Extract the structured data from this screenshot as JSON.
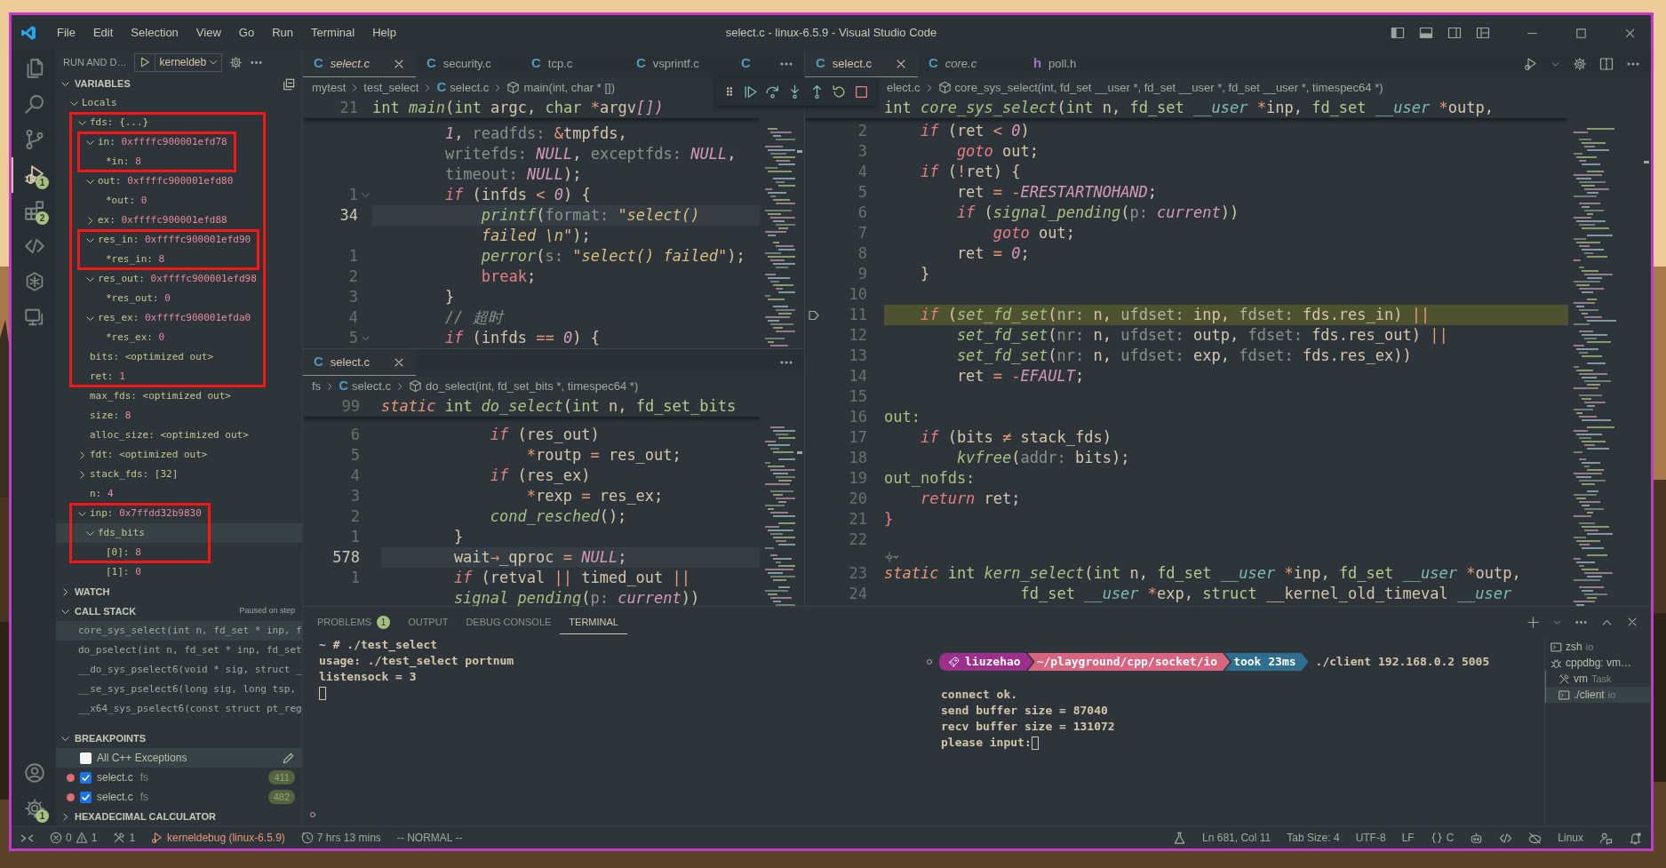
{
  "title_bar": {
    "menu": [
      "File",
      "Edit",
      "Selection",
      "View",
      "Go",
      "Run",
      "Terminal",
      "Help"
    ],
    "title": "select.c - linux-6.5.9 - Visual Studio Code"
  },
  "activity_bar": {
    "top": [
      {
        "kind": "files",
        "selected": false
      },
      {
        "kind": "search",
        "selected": false
      },
      {
        "kind": "source-control",
        "selected": false
      },
      {
        "kind": "run-debug",
        "selected": true,
        "badge": "1"
      },
      {
        "kind": "extensions",
        "selected": false,
        "badge": "2"
      },
      {
        "kind": "code",
        "selected": false
      },
      {
        "kind": "hexagon",
        "selected": false
      },
      {
        "kind": "monitor",
        "selected": false
      }
    ],
    "bottom": [
      {
        "kind": "account",
        "selected": false
      },
      {
        "kind": "gear",
        "selected": false,
        "badge": "1"
      }
    ]
  },
  "sidebar": {
    "title": "RUN AND D…",
    "launch_config": "kerneldeb",
    "variables": {
      "title": "VARIABLES",
      "expanded": true,
      "tree": [
        {
          "name": "Locals",
          "expanded": true,
          "children": [
            {
              "name": "fds:",
              "value": "{...}",
              "kind": "text",
              "expanded": true,
              "outline_start": true,
              "children": [
                {
                  "name": "in:",
                  "value": "0xffffc900001efd78",
                  "kind": "number",
                  "expanded": true,
                  "outline_start": true,
                  "children": [
                    {
                      "name": "*in:",
                      "value": "8",
                      "kind": "number",
                      "outline_end": true
                    }
                  ]
                },
                {
                  "name": "out:",
                  "value": "0xffffc900001efd80",
                  "kind": "number",
                  "expanded": true,
                  "children": [
                    {
                      "name": "*out:",
                      "value": "0",
                      "kind": "number"
                    }
                  ]
                },
                {
                  "name": "ex:",
                  "value": "0xffffc900001efd88",
                  "kind": "number",
                  "expanded": false
                },
                {
                  "name": "res_in:",
                  "value": "0xffffc900001efd90",
                  "kind": "number",
                  "expanded": true,
                  "outline_start": true,
                  "children": [
                    {
                      "name": "*res_in:",
                      "value": "8",
                      "kind": "number",
                      "outline_end": true
                    }
                  ]
                },
                {
                  "name": "res_out:",
                  "value": "0xffffc900001efd98",
                  "kind": "number",
                  "expanded": true,
                  "children": [
                    {
                      "name": "*res_out:",
                      "value": "0",
                      "kind": "number"
                    }
                  ]
                },
                {
                  "name": "res_ex:",
                  "value": "0xffffc900001efda0",
                  "kind": "number",
                  "expanded": true,
                  "children": [
                    {
                      "name": "*res_ex:",
                      "value": "0",
                      "kind": "number"
                    }
                  ]
                }
              ]
            },
            {
              "name": "bits:",
              "value": "<optimized out>",
              "kind": "text"
            },
            {
              "name": "ret:",
              "value": "1",
              "kind": "number",
              "outline_end": true
            },
            {
              "name": "max_fds:",
              "value": "<optimized out>",
              "kind": "text"
            },
            {
              "name": "size:",
              "value": "8",
              "kind": "number"
            },
            {
              "name": "alloc_size:",
              "value": "<optimized out>",
              "kind": "text"
            },
            {
              "name": "fdt:",
              "value": "<optimized out>",
              "kind": "text",
              "expanded": false
            },
            {
              "name": "stack_fds:",
              "value": "[32]",
              "kind": "text",
              "expanded": false
            },
            {
              "name": "n:",
              "value": "4",
              "kind": "number"
            },
            {
              "name": "inp:",
              "value": "0x7ffdd32b9830",
              "kind": "number",
              "expanded": true,
              "outline_start": true,
              "children": [
                {
                  "name": "fds_bits",
                  "expanded": true,
                  "highlighted": true,
                  "children": [
                    {
                      "name": "[0]:",
                      "value": "8",
                      "kind": "number",
                      "outline_end": true
                    },
                    {
                      "name": "[1]:",
                      "value": "0",
                      "kind": "number"
                    }
                  ]
                }
              ]
            }
          ]
        }
      ]
    },
    "watch": {
      "title": "WATCH",
      "expanded": false
    },
    "call_stack": {
      "title": "CALL STACK",
      "expanded": true,
      "status": "Paused on step",
      "frames": [
        {
          "text": "core_sys_select(int n, fd_set * inp, f",
          "selected": true
        },
        {
          "text": "do_pselect(int n, fd_set * inp, fd_set",
          "selected": false
        },
        {
          "text": "__do_sys_pselect6(void * sig, struct _",
          "selected": false
        },
        {
          "text": "__se_sys_pselect6(long sig, long tsp,",
          "selected": false
        },
        {
          "text": "__x64_sys_pselect6(const struct pt_reg",
          "selected": false
        }
      ]
    },
    "breakpoints": {
      "title": "BREAKPOINTS",
      "expanded": true,
      "items": [
        {
          "kind": "exception",
          "label": "All C++ Exceptions",
          "checked": false,
          "highlighted": true
        },
        {
          "kind": "source",
          "label": "select.c",
          "folder": "fs",
          "line": "411",
          "checked": true
        },
        {
          "kind": "source",
          "label": "select.c",
          "folder": "fs",
          "line": "482",
          "checked": true
        }
      ]
    },
    "hex_calculator": {
      "title": "HEXADECIMAL CALCULATOR",
      "expanded": false
    }
  },
  "debug_toolbar": {
    "buttons": [
      {
        "kind": "continue"
      },
      {
        "kind": "step-over"
      },
      {
        "kind": "step-into"
      },
      {
        "kind": "step-out"
      },
      {
        "kind": "restart"
      },
      {
        "kind": "stop"
      }
    ]
  },
  "editor_columns": [
    {
      "editors": [
        {
          "tabs": [
            {
              "glyph": "C",
              "color": "#519aba",
              "label": "select.c",
              "selected": true,
              "preview": true,
              "close_button": true
            },
            {
              "glyph": "C",
              "color": "#519aba",
              "label": "security.c",
              "selected": false
            },
            {
              "glyph": "C",
              "color": "#519aba",
              "label": "tcp.c",
              "selected": false
            },
            {
              "glyph": "C",
              "color": "#519aba",
              "label": "vsprintf.c",
              "selected": false
            },
            {
              "glyph": "C",
              "color": "#519aba",
              "selected": false
            }
          ],
          "actions": [
            {
              "kind": "more"
            }
          ],
          "breadcrumb": [
            {
              "kind": "folder",
              "text": "mytest"
            },
            {
              "kind": "folder",
              "text": "test_select"
            },
            {
              "kind": "file",
              "glyph": "C",
              "color": "#519aba",
              "text": "select.c"
            },
            {
              "kind": "symbol",
              "text": "main(int, char * [])"
            }
          ],
          "sticky": {
            "number": "21",
            "tokens": [
              {
                "kind": "ty",
                "text": "int"
              },
              {
                "kind": "fn",
                "text": " main"
              },
              {
                "kind": "pl",
                "text": "("
              },
              {
                "kind": "ty",
                "text": "int"
              },
              {
                "kind": "pl",
                "text": " argc, "
              },
              {
                "kind": "ty",
                "text": "char"
              },
              {
                "kind": "op",
                "text": " *"
              },
              {
                "kind": "pl",
                "text": "argv"
              },
              {
                "kind": "num",
                "text": "[])"
              }
            ]
          },
          "lines": [
            {
              "tokens": [
                {
                  "kind": "num",
                  "text": "        1"
                },
                {
                  "kind": "pl",
                  "text": ", "
                },
                {
                  "kind": "hint",
                  "text": "readfds:"
                },
                {
                  "kind": "op",
                  "text": " &"
                },
                {
                  "kind": "pl",
                  "text": "tmpfds,"
                }
              ]
            },
            {
              "tokens": [
                {
                  "kind": "hint",
                  "text": "        writefds:"
                },
                {
                  "kind": "num",
                  "text": " NULL"
                },
                {
                  "kind": "pl",
                  "text": ", "
                },
                {
                  "kind": "hint",
                  "text": "exceptfds:"
                },
                {
                  "kind": "num",
                  "text": " NULL"
                },
                {
                  "kind": "pl",
                  "text": ","
                }
              ]
            },
            {
              "tokens": [
                {
                  "kind": "hint",
                  "text": "        timeout:"
                },
                {
                  "kind": "num",
                  "text": " NULL"
                },
                {
                  "kind": "pl",
                  "text": ");"
                }
              ]
            },
            {
              "number": "1",
              "foldable": true,
              "tokens": [
                {
                  "kind": "kw",
                  "text": "        if"
                },
                {
                  "kind": "pl",
                  "text": " (infds "
                },
                {
                  "kind": "op",
                  "text": "<"
                },
                {
                  "kind": "num",
                  "text": " 0"
                },
                {
                  "kind": "pl",
                  "text": ") {"
                }
              ]
            },
            {
              "number": "34",
              "current": true,
              "tokens": [
                {
                  "kind": "fn",
                  "text": "            printf"
                },
                {
                  "kind": "pl",
                  "text": "("
                },
                {
                  "kind": "hint",
                  "text": "format:"
                },
                {
                  "kind": "str",
                  "text": " \"select()"
                }
              ]
            },
            {
              "tokens": [
                {
                  "kind": "str",
                  "text": "            failed \\n\""
                },
                {
                  "kind": "pl",
                  "text": ");"
                }
              ]
            },
            {
              "number": "1",
              "tokens": [
                {
                  "kind": "fn",
                  "text": "            perror"
                },
                {
                  "kind": "pl",
                  "text": "("
                },
                {
                  "kind": "hint",
                  "text": "s:"
                },
                {
                  "kind": "str",
                  "text": " \"select() failed\""
                },
                {
                  "kind": "pl",
                  "text": ");"
                }
              ]
            },
            {
              "number": "2",
              "tokens": [
                {
                  "kind": "br",
                  "text": "            break"
                },
                {
                  "kind": "pl",
                  "text": ";"
                }
              ]
            },
            {
              "number": "3",
              "tokens": [
                {
                  "kind": "pl",
                  "text": "        }"
                }
              ]
            },
            {
              "number": "4",
              "tokens": [
                {
                  "kind": "cmt",
                  "text": "        // 超时"
                }
              ]
            },
            {
              "number": "5",
              "foldable": true,
              "tokens": [
                {
                  "kind": "kw",
                  "text": "        if"
                },
                {
                  "kind": "pl",
                  "text": " (infds "
                },
                {
                  "kind": "op",
                  "text": "=="
                },
                {
                  "kind": "num",
                  "text": " 0"
                },
                {
                  "kind": "pl",
                  "text": ") {"
                }
              ]
            }
          ]
        },
        {
          "tabs": [
            {
              "glyph": "C",
              "color": "#519aba",
              "label": "select.c",
              "selected": true,
              "close_button": true
            }
          ],
          "actions": [
            {
              "kind": "more"
            }
          ],
          "breadcrumb": [
            {
              "kind": "folder",
              "text": "fs"
            },
            {
              "kind": "file",
              "glyph": "C",
              "color": "#519aba",
              "text": "select.c"
            },
            {
              "kind": "symbol",
              "text": "do_select(int, fd_set_bits *, timespec64 *)"
            }
          ],
          "sticky": {
            "number": "99",
            "tokens": [
              {
                "kind": "sto",
                "text": "static"
              },
              {
                "kind": "ty",
                "text": " int"
              },
              {
                "kind": "fn",
                "text": " do_select"
              },
              {
                "kind": "pl",
                "text": "("
              },
              {
                "kind": "ty",
                "text": "int"
              },
              {
                "kind": "pl",
                "text": " n, "
              },
              {
                "kind": "ty",
                "text": "fd_set_bits"
              }
            ]
          },
          "lines": [
            {
              "number": "6",
              "tokens": [
                {
                  "kind": "kw",
                  "text": "            if"
                },
                {
                  "kind": "pl",
                  "text": " (res_out)"
                }
              ]
            },
            {
              "number": "5",
              "tokens": [
                {
                  "kind": "op",
                  "text": "                *"
                },
                {
                  "kind": "pl",
                  "text": "routp "
                },
                {
                  "kind": "op",
                  "text": "="
                },
                {
                  "kind": "pl",
                  "text": " res_out;"
                }
              ]
            },
            {
              "number": "4",
              "tokens": [
                {
                  "kind": "kw",
                  "text": "            if"
                },
                {
                  "kind": "pl",
                  "text": " (res_ex)"
                }
              ]
            },
            {
              "number": "3",
              "tokens": [
                {
                  "kind": "op",
                  "text": "                *"
                },
                {
                  "kind": "pl",
                  "text": "rexp "
                },
                {
                  "kind": "op",
                  "text": "="
                },
                {
                  "kind": "pl",
                  "text": " res_ex;"
                }
              ]
            },
            {
              "number": "2",
              "tokens": [
                {
                  "kind": "fn",
                  "text": "            cond_resched"
                },
                {
                  "kind": "pl",
                  "text": "();"
                }
              ]
            },
            {
              "number": "1",
              "tokens": [
                {
                  "kind": "pl",
                  "text": "        }"
                }
              ]
            },
            {
              "number": "578",
              "current": true,
              "tokens": [
                {
                  "kind": "pl",
                  "text": "        wait"
                },
                {
                  "kind": "op",
                  "text": "→"
                },
                {
                  "kind": "pl",
                  "text": "_qproc "
                },
                {
                  "kind": "op",
                  "text": "="
                },
                {
                  "kind": "num",
                  "text": " NULL"
                },
                {
                  "kind": "pl",
                  "text": ";"
                }
              ]
            },
            {
              "number": "1",
              "tokens": [
                {
                  "kind": "kw",
                  "text": "        if"
                },
                {
                  "kind": "pl",
                  "text": " (retval "
                },
                {
                  "kind": "op",
                  "text": "||"
                },
                {
                  "kind": "pl",
                  "text": " timed_out "
                },
                {
                  "kind": "op",
                  "text": "||"
                }
              ]
            },
            {
              "tokens": [
                {
                  "kind": "fn",
                  "text": "        signal_pending"
                },
                {
                  "kind": "pl",
                  "text": "("
                },
                {
                  "kind": "hint",
                  "text": "p:"
                },
                {
                  "kind": "num",
                  "text": " current"
                },
                {
                  "kind": "pl",
                  "text": "))"
                }
              ]
            }
          ]
        }
      ]
    },
    {
      "editors": [
        {
          "tabs": [
            {
              "glyph": "C",
              "color": "#519aba",
              "label": "select.c",
              "selected": true,
              "close_button": true
            },
            {
              "glyph": "C",
              "color": "#519aba",
              "label": "core.c",
              "selected": false,
              "preview": true
            },
            {
              "glyph": "h",
              "color": "#a074c4",
              "label": "poll.h",
              "selected": false
            }
          ],
          "actions": [
            {
              "kind": "run"
            },
            {
              "kind": "gear"
            },
            {
              "kind": "split"
            },
            {
              "kind": "more"
            }
          ],
          "breadcrumb": [
            {
              "kind": "file",
              "text": "elect.c"
            },
            {
              "kind": "symbol",
              "text": "core_sys_select(int, fd_set __user *, fd_set __user *, fd_set __user *, timespec64 *)"
            }
          ],
          "sticky": {
            "tokens": [
              {
                "kind": "ty",
                "text": "int"
              },
              {
                "kind": "fn",
                "text": " core_sys_select"
              },
              {
                "kind": "pl",
                "text": "("
              },
              {
                "kind": "ty",
                "text": "int"
              },
              {
                "kind": "pl",
                "text": " n, "
              },
              {
                "kind": "ty",
                "text": "fd_set"
              },
              {
                "kind": "qual",
                "text": " __user"
              },
              {
                "kind": "op",
                "text": " *"
              },
              {
                "kind": "pl",
                "text": "inp, "
              },
              {
                "kind": "ty",
                "text": "fd_set"
              },
              {
                "kind": "qual",
                "text": " __user"
              },
              {
                "kind": "op",
                "text": " *"
              },
              {
                "kind": "pl",
                "text": "outp,"
              }
            ]
          },
          "lines": [
            {
              "number": "2",
              "tokens": [
                {
                  "kind": "kw",
                  "text": "    if"
                },
                {
                  "kind": "pl",
                  "text": " (ret "
                },
                {
                  "kind": "op",
                  "text": "<"
                },
                {
                  "kind": "num",
                  "text": " 0"
                },
                {
                  "kind": "pl",
                  "text": ")"
                }
              ]
            },
            {
              "number": "3",
              "tokens": [
                {
                  "kind": "kw",
                  "text": "        goto"
                },
                {
                  "kind": "pl",
                  "text": " out;"
                }
              ]
            },
            {
              "number": "4",
              "tokens": [
                {
                  "kind": "kw",
                  "text": "    if"
                },
                {
                  "kind": "pl",
                  "text": " ("
                },
                {
                  "kind": "op",
                  "text": "!"
                },
                {
                  "kind": "pl",
                  "text": "ret) {"
                }
              ]
            },
            {
              "number": "5",
              "tokens": [
                {
                  "kind": "pl",
                  "text": "        ret "
                },
                {
                  "kind": "op",
                  "text": "= -"
                },
                {
                  "kind": "num",
                  "text": "ERESTARTNOHAND"
                },
                {
                  "kind": "pl",
                  "text": ";"
                }
              ]
            },
            {
              "number": "6",
              "tokens": [
                {
                  "kind": "kw",
                  "text": "        if"
                },
                {
                  "kind": "pl",
                  "text": " ("
                },
                {
                  "kind": "fn",
                  "text": "signal_pending"
                },
                {
                  "kind": "pl",
                  "text": "("
                },
                {
                  "kind": "hint",
                  "text": "p:"
                },
                {
                  "kind": "num",
                  "text": " current"
                },
                {
                  "kind": "pl",
                  "text": "))"
                }
              ]
            },
            {
              "number": "7",
              "tokens": [
                {
                  "kind": "kw",
                  "text": "            goto"
                },
                {
                  "kind": "pl",
                  "text": " out;"
                }
              ]
            },
            {
              "number": "8",
              "tokens": [
                {
                  "kind": "pl",
                  "text": "        ret "
                },
                {
                  "kind": "op",
                  "text": "="
                },
                {
                  "kind": "num",
                  "text": " 0"
                },
                {
                  "kind": "pl",
                  "text": ";"
                }
              ]
            },
            {
              "number": "9",
              "tokens": [
                {
                  "kind": "pl",
                  "text": "    }"
                }
              ]
            },
            {
              "number": "10"
            },
            {
              "number": "11",
              "paused": true,
              "tokens": [
                {
                  "kind": "kw",
                  "text": "    if"
                },
                {
                  "kind": "pl",
                  "text": " ("
                },
                {
                  "kind": "fn",
                  "text": "set_fd_set"
                },
                {
                  "kind": "pl",
                  "text": "("
                },
                {
                  "kind": "hint",
                  "text": "nr:"
                },
                {
                  "kind": "pl",
                  "text": " n, "
                },
                {
                  "kind": "hint",
                  "text": "ufdset:"
                },
                {
                  "kind": "pl",
                  "text": " inp, "
                },
                {
                  "kind": "hint",
                  "text": "fdset:"
                },
                {
                  "kind": "pl",
                  "text": " fds.res_in) "
                },
                {
                  "kind": "op",
                  "text": "||"
                }
              ]
            },
            {
              "number": "12",
              "tokens": [
                {
                  "kind": "fn",
                  "text": "        set_fd_set"
                },
                {
                  "kind": "pl",
                  "text": "("
                },
                {
                  "kind": "hint",
                  "text": "nr:"
                },
                {
                  "kind": "pl",
                  "text": " n, "
                },
                {
                  "kind": "hint",
                  "text": "ufdset:"
                },
                {
                  "kind": "pl",
                  "text": " outp, "
                },
                {
                  "kind": "hint",
                  "text": "fdset:"
                },
                {
                  "kind": "pl",
                  "text": " fds.res_out) "
                },
                {
                  "kind": "op",
                  "text": "||"
                }
              ]
            },
            {
              "number": "13",
              "tokens": [
                {
                  "kind": "fn",
                  "text": "        set_fd_set"
                },
                {
                  "kind": "pl",
                  "text": "("
                },
                {
                  "kind": "hint",
                  "text": "nr:"
                },
                {
                  "kind": "pl",
                  "text": " n, "
                },
                {
                  "kind": "hint",
                  "text": "ufdset:"
                },
                {
                  "kind": "pl",
                  "text": " exp, "
                },
                {
                  "kind": "hint",
                  "text": "fdset:"
                },
                {
                  "kind": "pl",
                  "text": " fds.res_ex))"
                }
              ]
            },
            {
              "number": "14",
              "tokens": [
                {
                  "kind": "pl",
                  "text": "        ret "
                },
                {
                  "kind": "op",
                  "text": "= -"
                },
                {
                  "kind": "num",
                  "text": "EFAULT"
                },
                {
                  "kind": "pl",
                  "text": ";"
                }
              ]
            },
            {
              "number": "15"
            },
            {
              "number": "16",
              "tokens": [
                {
                  "kind": "lbl",
                  "text": "out:"
                }
              ]
            },
            {
              "number": "17",
              "tokens": [
                {
                  "kind": "kw",
                  "text": "    if"
                },
                {
                  "kind": "pl",
                  "text": " (bits "
                },
                {
                  "kind": "op",
                  "text": "≠"
                },
                {
                  "kind": "pl",
                  "text": " stack_fds)"
                }
              ]
            },
            {
              "number": "18",
              "tokens": [
                {
                  "kind": "fn",
                  "text": "        kvfree"
                },
                {
                  "kind": "pl",
                  "text": "("
                },
                {
                  "kind": "hint",
                  "text": "addr:"
                },
                {
                  "kind": "pl",
                  "text": " bits);"
                }
              ]
            },
            {
              "number": "19",
              "tokens": [
                {
                  "kind": "lbl",
                  "text": "out_nofds:"
                }
              ]
            },
            {
              "number": "20",
              "tokens": [
                {
                  "kind": "kw",
                  "text": "    return"
                },
                {
                  "kind": "pl",
                  "text": " ret;"
                }
              ]
            },
            {
              "number": "21",
              "tokens": [
                {
                  "kind": "br",
                  "text": "}"
                }
              ]
            },
            {
              "number": "22"
            },
            {
              "number": "23",
              "codelens": true,
              "tokens": [
                {
                  "kind": "sto",
                  "text": "static"
                },
                {
                  "kind": "ty",
                  "text": " int"
                },
                {
                  "kind": "fn",
                  "text": " kern_select"
                },
                {
                  "kind": "pl",
                  "text": "("
                },
                {
                  "kind": "ty",
                  "text": "int"
                },
                {
                  "kind": "pl",
                  "text": " n, "
                },
                {
                  "kind": "ty",
                  "text": "fd_set"
                },
                {
                  "kind": "qual",
                  "text": " __user"
                },
                {
                  "kind": "op",
                  "text": " *"
                },
                {
                  "kind": "pl",
                  "text": "inp, "
                },
                {
                  "kind": "ty",
                  "text": "fd_set"
                },
                {
                  "kind": "qual",
                  "text": " __user"
                },
                {
                  "kind": "op",
                  "text": " *"
                },
                {
                  "kind": "pl",
                  "text": "outp,"
                }
              ]
            },
            {
              "number": "24",
              "tokens": [
                {
                  "kind": "ty",
                  "text": "               fd_set"
                },
                {
                  "kind": "qual",
                  "text": " __user"
                },
                {
                  "kind": "op",
                  "text": " *"
                },
                {
                  "kind": "pl",
                  "text": "exp, "
                },
                {
                  "kind": "ty",
                  "text": "struct"
                },
                {
                  "kind": "pl",
                  "text": " __kernel_old_timeval "
                },
                {
                  "kind": "qual",
                  "text": "__user"
                }
              ]
            }
          ]
        }
      ]
    }
  ],
  "panel": {
    "tabs": [
      {
        "label": "PROBLEMS",
        "badge": "1",
        "selected": false
      },
      {
        "label": "OUTPUT",
        "selected": false
      },
      {
        "label": "DEBUG CONSOLE",
        "selected": false
      },
      {
        "label": "TERMINAL",
        "selected": true
      }
    ],
    "left_terminal": {
      "lines": [
        "~ # ./test_select",
        "usage: ./test_select portnum",
        "listensock = 3"
      ],
      "cursor": true
    },
    "right_terminal": {
      "prompt": [
        {
          "text": "liuzehao",
          "color": "#9b2f8c"
        },
        {
          "text": "~/playground/cpp/socket/io",
          "color": "#d8657f"
        },
        {
          "text": "took 23ms",
          "color": "#2e6f8e"
        }
      ],
      "command": "./client 192.168.0.2 5005",
      "lines": [
        "connect ok.",
        "send buffer size = 87040",
        "recv buffer size = 131072",
        "please input:"
      ],
      "cursor": true
    },
    "terminal_list": [
      {
        "kind": "shell",
        "label": "zsh",
        "detail": "io",
        "selected": false
      },
      {
        "kind": "debug",
        "label": "cppdbg: vm…",
        "selected": false
      },
      {
        "kind": "task",
        "label": "vm",
        "detail": "Task",
        "selected": false,
        "grouped": true
      },
      {
        "kind": "shell",
        "label": "./client",
        "detail": "io",
        "selected": true,
        "grouped": true
      }
    ]
  },
  "status_bar": {
    "left": [
      {
        "kind": "remote"
      },
      {
        "kind": "problems",
        "errors": "0",
        "warnings": "1"
      },
      {
        "kind": "tools",
        "text": "1"
      },
      {
        "kind": "debug",
        "text": "kerneldebug (linux-6.5.9)"
      },
      {
        "kind": "timer",
        "text": "7 hrs 13 mins"
      },
      {
        "kind": "text",
        "text": "-- NORMAL --"
      }
    ],
    "right": [
      {
        "kind": "flask"
      },
      {
        "kind": "text",
        "text": "Ln 681, Col 11"
      },
      {
        "kind": "text",
        "text": "Tab Size: 4"
      },
      {
        "kind": "text",
        "text": "UTF-8"
      },
      {
        "kind": "text",
        "text": "LF"
      },
      {
        "kind": "language",
        "text": "C"
      },
      {
        "kind": "bot"
      },
      {
        "kind": "code"
      },
      {
        "kind": "slash"
      },
      {
        "kind": "text",
        "text": "Linux"
      },
      {
        "kind": "feedback"
      },
      {
        "kind": "bell"
      }
    ]
  }
}
